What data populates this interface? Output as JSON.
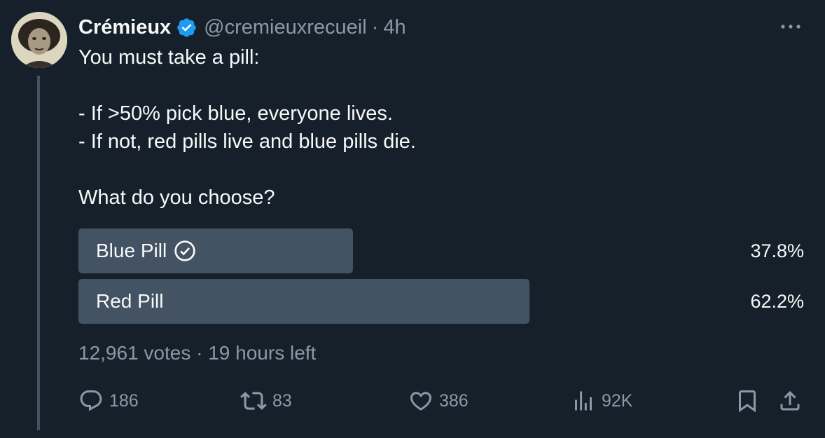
{
  "tweet": {
    "author_name": "Crémieux",
    "handle": "@cremieuxrecueil",
    "separator": "·",
    "time": "4h",
    "lines": [
      "You must take a pill:",
      "- If >50% pick blue, everyone lives.",
      "- If not, red pills live and blue pills die.",
      "What do you choose?"
    ]
  },
  "poll": {
    "options": [
      {
        "label": "Blue Pill",
        "percent_text": "37.8%",
        "percent": 37.8,
        "voted": true
      },
      {
        "label": "Red Pill",
        "percent_text": "62.2%",
        "percent": 62.2,
        "voted": false
      }
    ],
    "votes": "12,961 votes",
    "separator": "·",
    "time_left": "19 hours left"
  },
  "actions": {
    "replies": "186",
    "reposts": "83",
    "likes": "386",
    "views": "92K"
  },
  "colors": {
    "background": "#15202b",
    "text": "#f7f9f9",
    "secondary_text": "#8b98a5",
    "poll_fill": "#435364",
    "verified_badge": "#1d9bf0"
  },
  "icons": {
    "verified": "verified-badge-icon",
    "more": "more-horizontal-icon",
    "voted": "check-circle-icon",
    "reply": "reply-icon",
    "repost": "repost-icon",
    "like": "heart-icon",
    "views": "views-chart-icon",
    "bookmark": "bookmark-icon",
    "share": "share-icon"
  }
}
